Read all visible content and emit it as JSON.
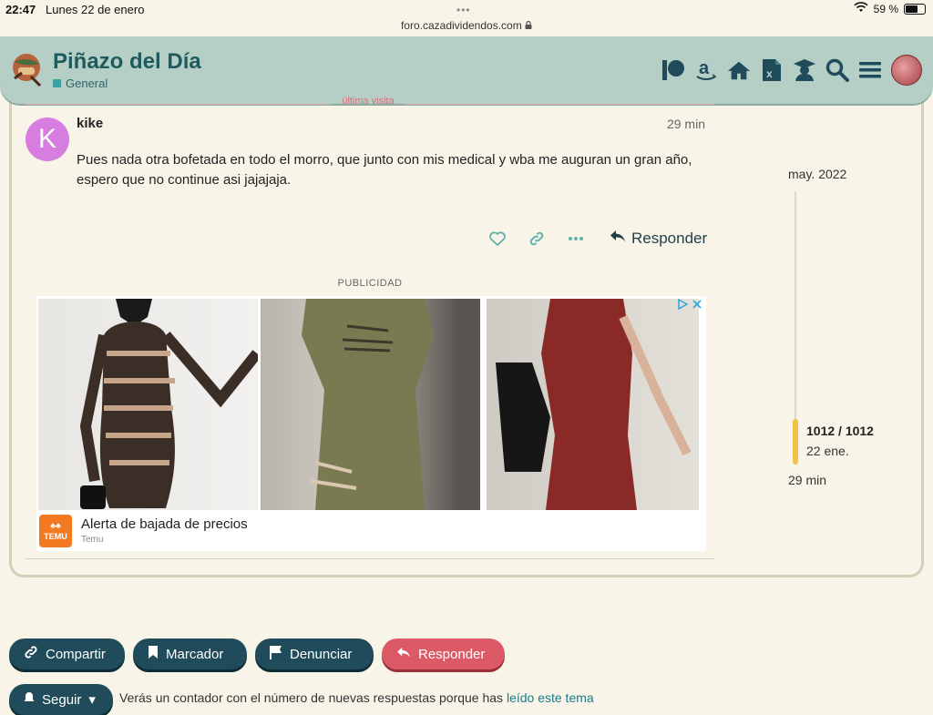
{
  "status_bar": {
    "time": "22:47",
    "date": "Lunes 22 de enero",
    "url": "foro.cazadividendos.com",
    "battery": "59 %"
  },
  "header": {
    "title": "Piñazo del Día",
    "category": "General",
    "icons": [
      "patreon-icon",
      "amazon-icon",
      "home-icon",
      "excel-icon",
      "graduation-icon",
      "search-icon",
      "menu-icon",
      "user-avatar"
    ]
  },
  "topic": {
    "last_visit": "última visita"
  },
  "post": {
    "avatar_letter": "K",
    "username": "kike",
    "time": "29 min",
    "body": "Pues nada otra bofetada en todo el morro, que junto con mis medical y wba me auguran un gran año, espero que no continue asi jajajaja.",
    "reply_label": "Responder"
  },
  "ad": {
    "label": "PUBLICIDAD",
    "logo_text": "TEMU",
    "title": "Alerta de bajada de precios",
    "advertiser": "Temu"
  },
  "timeline": {
    "start": "may. 2022",
    "position": "1012 / 1012",
    "current_date": "22 ene.",
    "end": "29 min",
    "progress_fraction": 1.0
  },
  "buttons": {
    "share": "Compartir",
    "bookmark": "Marcador",
    "flag": "Denunciar",
    "reply": "Responder",
    "follow": "Seguir"
  },
  "notice": {
    "text": "Verás un contador con el número de nuevas respuestas porque has ",
    "link": "leído este tema"
  },
  "colors": {
    "header_bg": "#b5cfc7",
    "title": "#1f5a5c",
    "button_dark": "#1f4b5a",
    "button_reply": "#dc5a66",
    "avatar": "#d77de0",
    "timeline_handle": "#f0c04a"
  }
}
